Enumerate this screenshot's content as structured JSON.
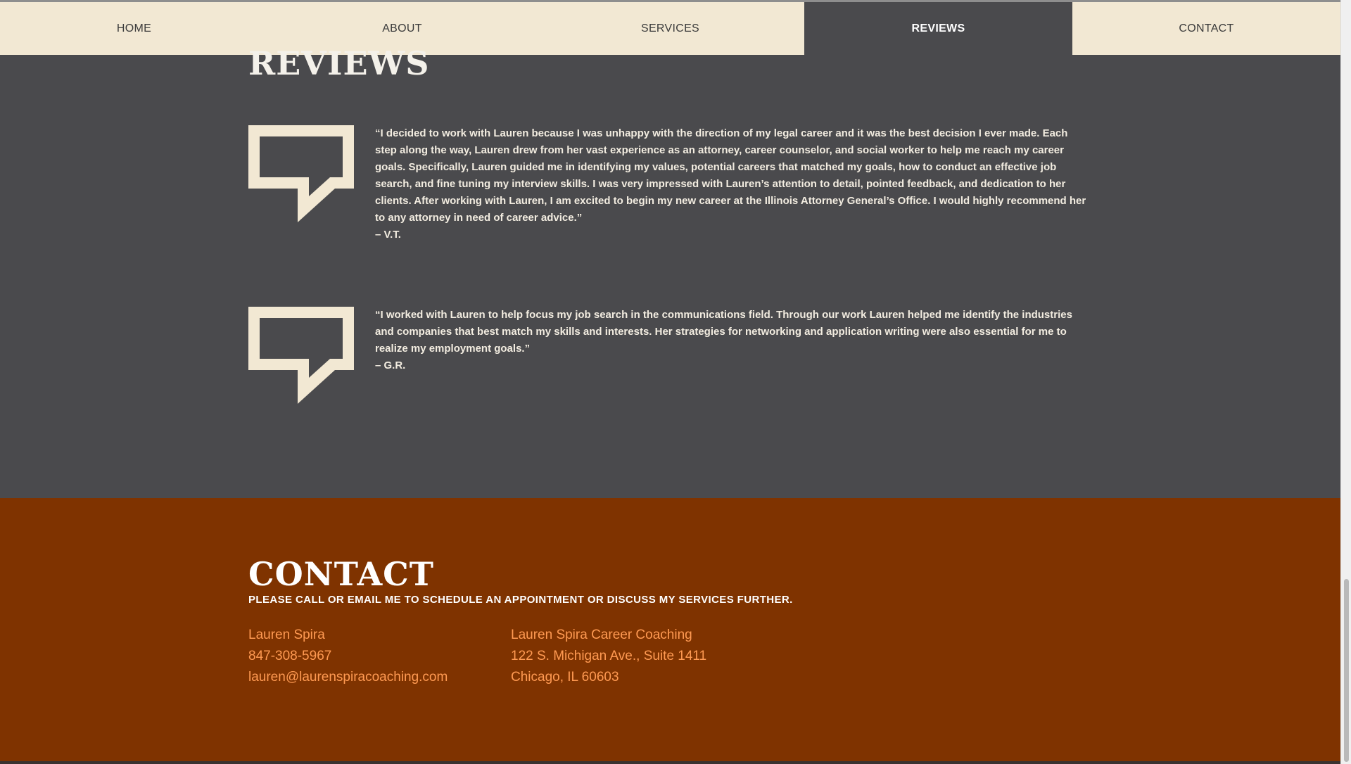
{
  "nav": {
    "items": [
      {
        "label": "HOME"
      },
      {
        "label": "ABOUT"
      },
      {
        "label": "SERVICES"
      },
      {
        "label": "REVIEWS"
      },
      {
        "label": "CONTACT"
      }
    ],
    "active": "REVIEWS"
  },
  "reviews": {
    "title": "REVIEWS",
    "items": [
      {
        "icon": "speech-bubble-icon",
        "quote": "“I decided to work with Lauren because I was unhappy with the direction of my legal career and it was the best decision I ever made. Each step along the way, Lauren drew from her vast experience as an attorney, career counselor, and social worker to help me reach my career goals. Specifically, Lauren guided me in identifying my values, potential careers that matched my goals, how to conduct an effective job search, and fine tuning my interview skills. I was very impressed with Lauren’s attention to detail, pointed feedback, and dedication to her clients. After working with Lauren, I am excited to begin my new career at the Illinois Attorney General’s Office. I would highly recommend her to any attorney in need of career advice.”",
        "author": "– V.T."
      },
      {
        "icon": "speech-bubble-icon",
        "quote": "“I worked with Lauren to help focus my job search in the communications field. Through our work Lauren helped me identify the industries and companies that best match my skills and interests. Her strategies for networking and application writing were also essential for me to realize my employment goals.”",
        "author": "– G.R."
      }
    ]
  },
  "contact": {
    "title": "CONTACT",
    "subtitle": "PLEASE CALL OR EMAIL ME TO SCHEDULE AN APPOINTMENT OR DISCUSS MY SERVICES FURTHER.",
    "name": "Lauren Spira",
    "phone": "847-308-5967",
    "email": "lauren@laurenspiracoaching.com",
    "business": "Lauren Spira Career Coaching",
    "address_line1": "122 S. Michigan Ave., Suite 1411",
    "address_line2": "Chicago, IL 60603"
  },
  "colors": {
    "nav_bg": "#f2e8d3",
    "reviews_bg": "#4a4a4d",
    "contact_bg": "#7f3300",
    "contact_link": "#ff9a52",
    "icon_cream": "#f2e8d3"
  }
}
